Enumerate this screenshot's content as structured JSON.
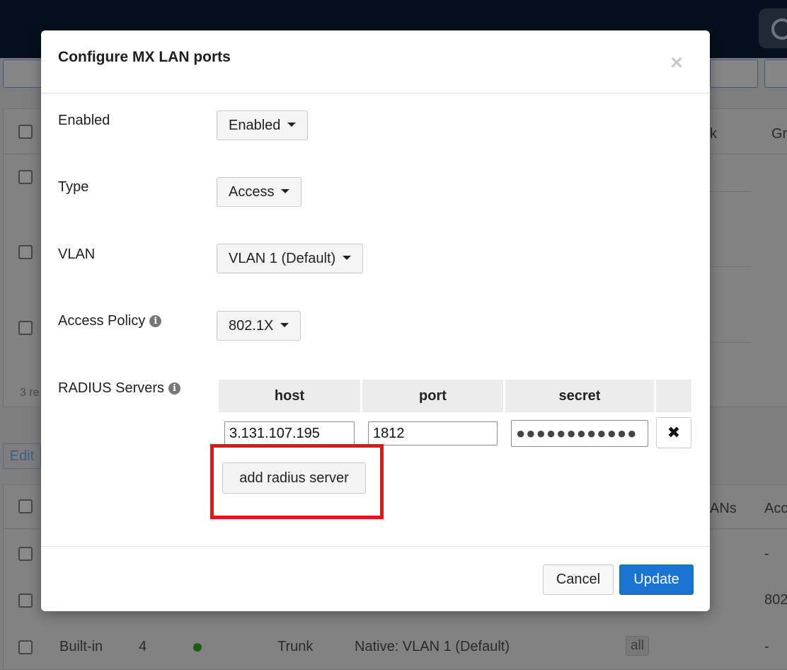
{
  "background": {
    "partial_texts": [
      "3 re",
      "Edit",
      "k",
      "Gr",
      "ANs",
      "Acc",
      "-",
      "802",
      "-"
    ],
    "bottom_row": {
      "type": "Built-in",
      "number": "4",
      "mode": "Trunk",
      "vlan": "Native: VLAN 1 (Default)",
      "allowed": "all",
      "access": "-"
    }
  },
  "modal": {
    "title": "Configure MX LAN ports",
    "close_label": "×",
    "fields": {
      "enabled": {
        "label": "Enabled",
        "value": "Enabled"
      },
      "type": {
        "label": "Type",
        "value": "Access"
      },
      "vlan": {
        "label": "VLAN",
        "value": "VLAN 1 (Default)"
      },
      "access_policy": {
        "label": "Access Policy",
        "value": "802.1X"
      },
      "radius": {
        "label": "RADIUS Servers"
      }
    },
    "radius_table": {
      "headers": [
        "host",
        "port",
        "secret"
      ],
      "row": {
        "host": "3.131.107.195",
        "port": "1812",
        "secret": "●●●●●●●●●●●●"
      },
      "remove_label": "✖",
      "add_label": "add radius server"
    },
    "footer": {
      "cancel": "Cancel",
      "update": "Update"
    }
  }
}
